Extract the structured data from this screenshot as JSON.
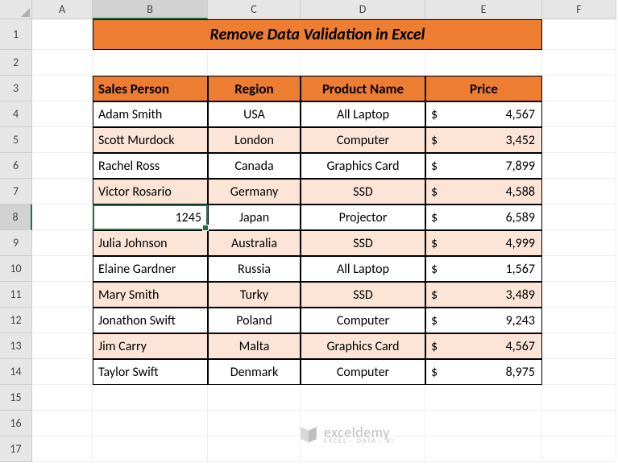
{
  "columns": [
    "A",
    "B",
    "C",
    "D",
    "E",
    "F"
  ],
  "row_numbers": [
    "1",
    "2",
    "3",
    "4",
    "5",
    "6",
    "7",
    "8",
    "9",
    "10",
    "11",
    "12",
    "13",
    "14",
    "15",
    "16",
    "17"
  ],
  "title": "Remove Data Validation in Excel",
  "headers": {
    "b": "Sales Person",
    "c": "Region",
    "d": "Product Name",
    "e": "Price"
  },
  "active_cell_value": "1245",
  "rows": [
    {
      "b": "Adam Smith",
      "c": "USA",
      "d": "All Laptop",
      "e": "4,567",
      "band": false
    },
    {
      "b": "Scott Murdock",
      "c": "London",
      "d": "Computer",
      "e": "3,452",
      "band": true
    },
    {
      "b": "Rachel Ross",
      "c": "Canada",
      "d": "Graphics Card",
      "e": "7,899",
      "band": false
    },
    {
      "b": "Victor Rosario",
      "c": "Germany",
      "d": "SSD",
      "e": "4,588",
      "band": true
    },
    {
      "b": "1245",
      "c": "Japan",
      "d": "Projector",
      "e": "6,589",
      "band": false,
      "active": true
    },
    {
      "b": "Julia Johnson",
      "c": "Australia",
      "d": "SSD",
      "e": "4,999",
      "band": true
    },
    {
      "b": "Elaine Gardner",
      "c": "Russia",
      "d": "All Laptop",
      "e": "1,567",
      "band": false
    },
    {
      "b": "Mary Smith",
      "c": "Turky",
      "d": "SSD",
      "e": "3,489",
      "band": true
    },
    {
      "b": "Jonathon Swift",
      "c": "Poland",
      "d": "Computer",
      "e": "9,243",
      "band": false
    },
    {
      "b": "Jim Carry",
      "c": "Malta",
      "d": "Graphics Card",
      "e": "4,567",
      "band": true
    },
    {
      "b": "Taylor Swift",
      "c": "Denmark",
      "d": "Computer",
      "e": "8,975",
      "band": false
    }
  ],
  "currency": "$",
  "logo": {
    "main": "exceldemy",
    "sub": "EXCEL · DATA · BI"
  }
}
